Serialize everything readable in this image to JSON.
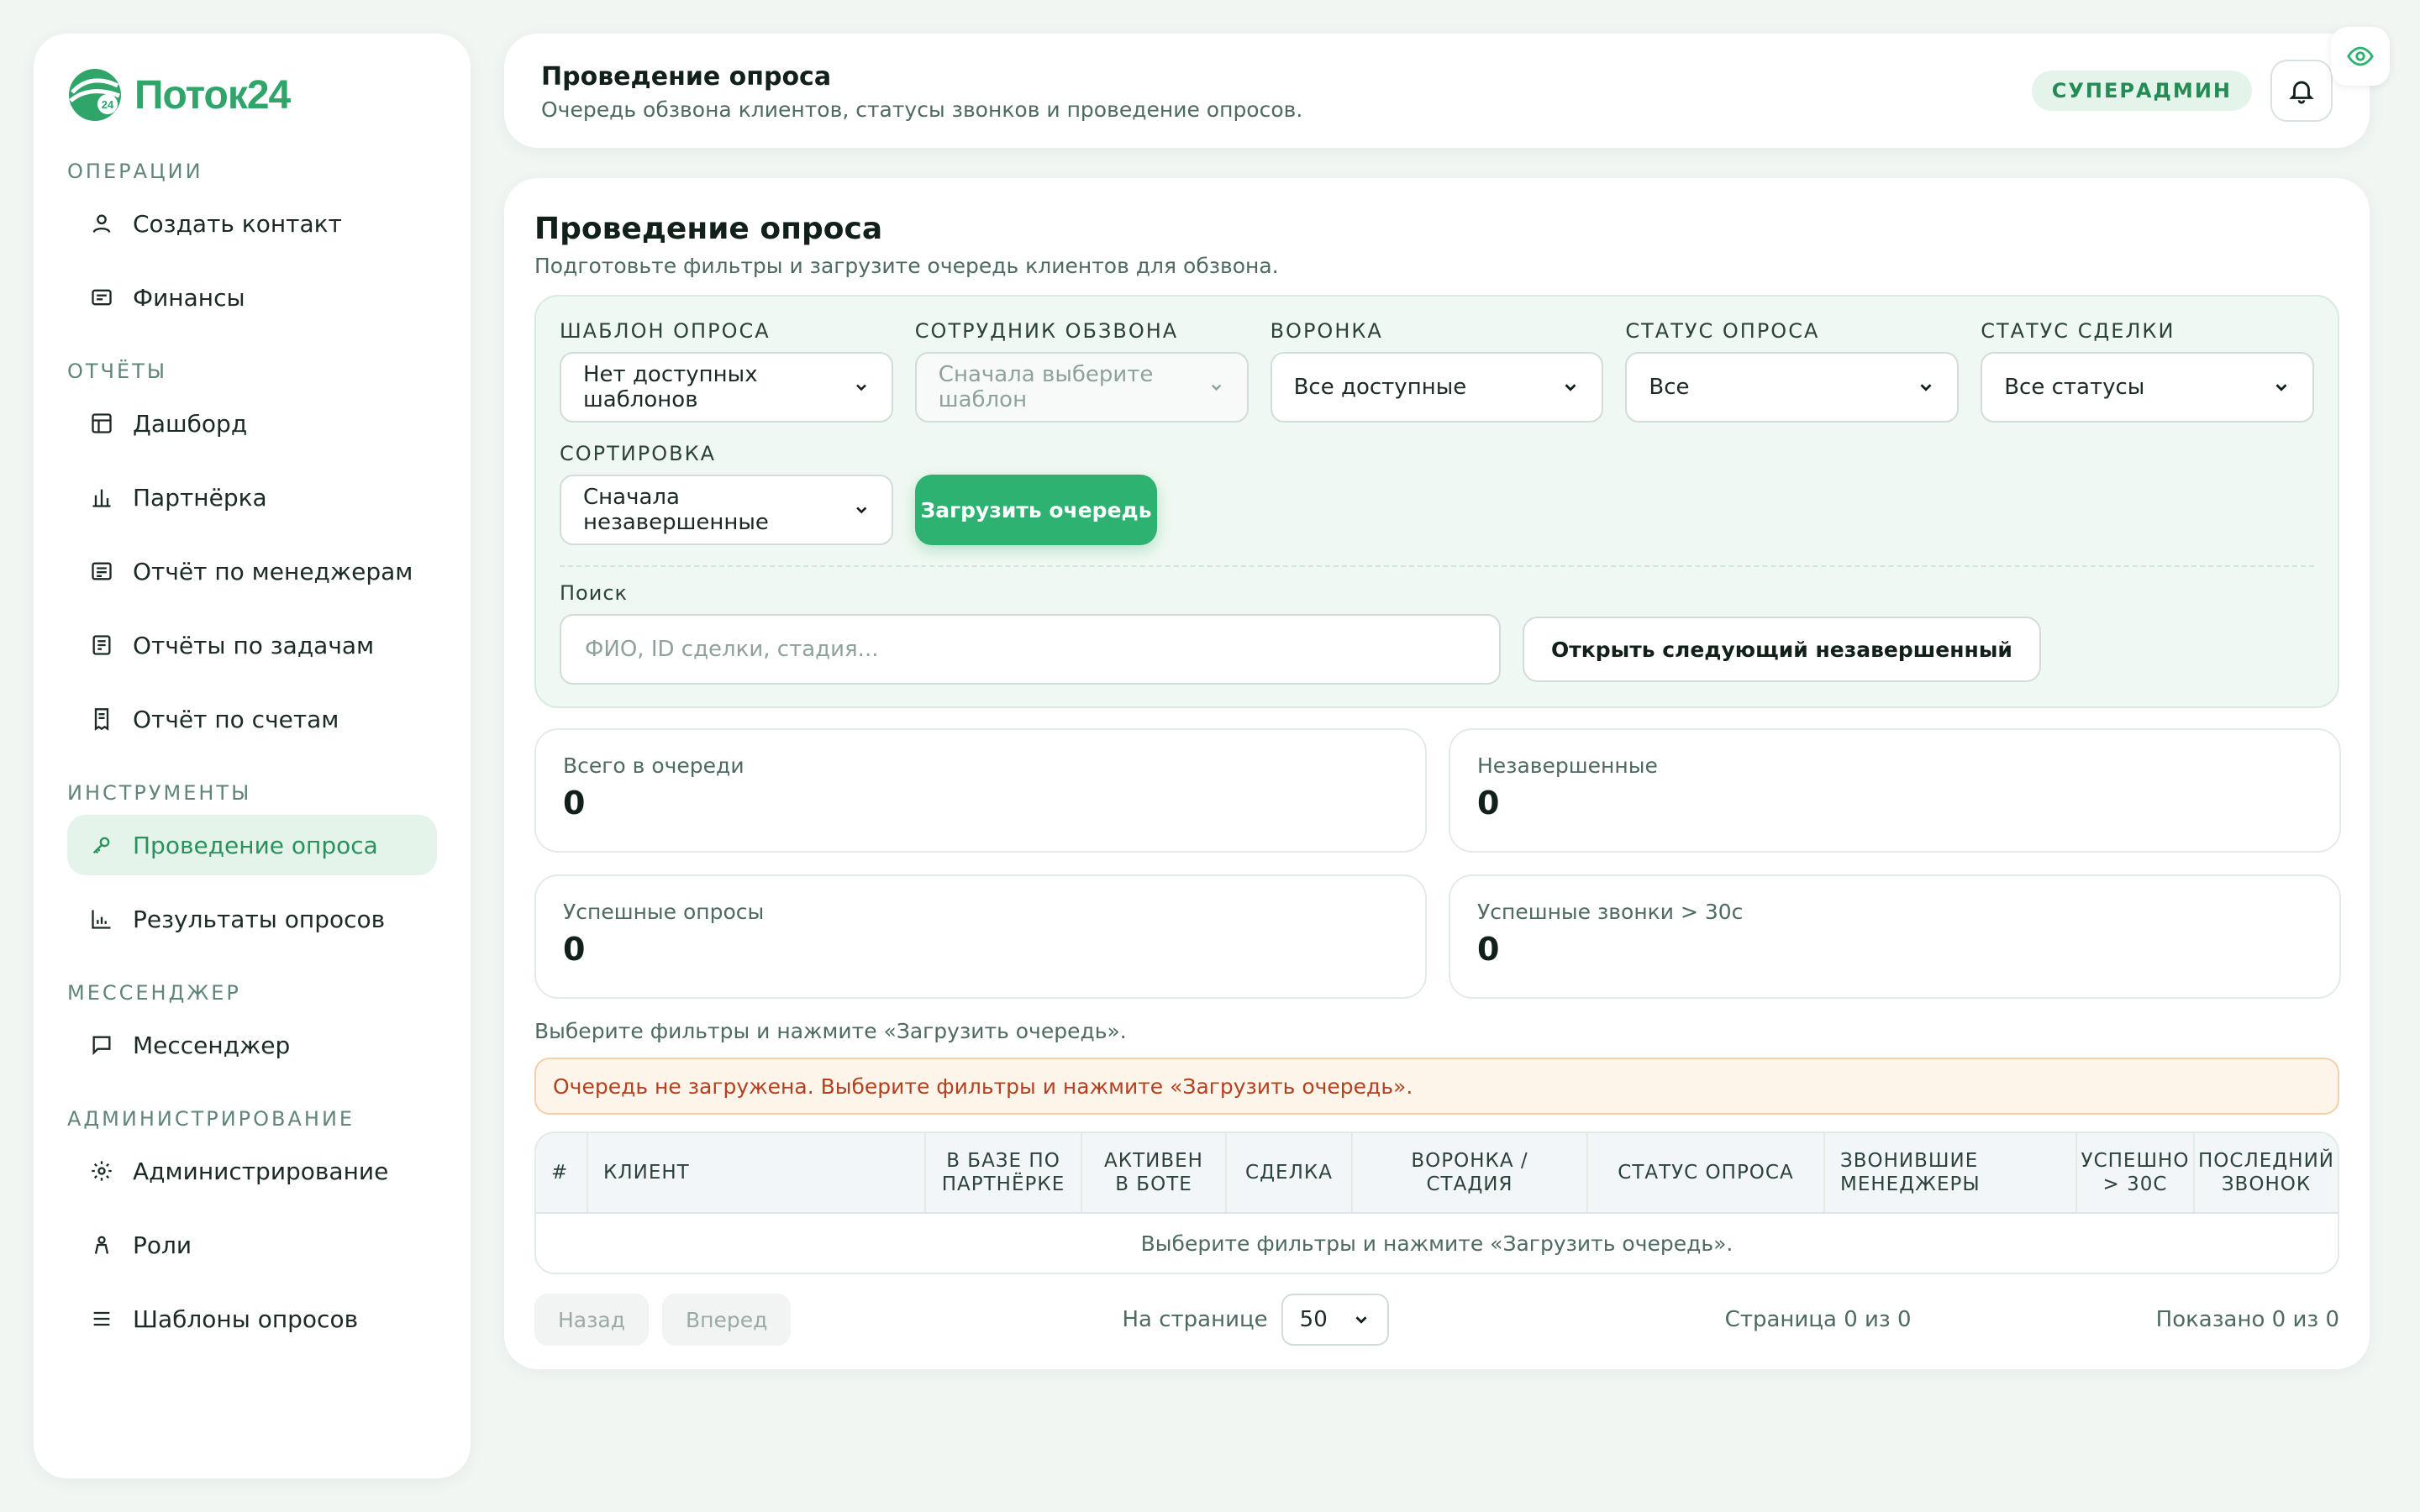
{
  "brand": {
    "name": "Поток24",
    "badge": "24",
    "color": "#2fa56a"
  },
  "sidebar": {
    "sections": [
      {
        "heading": "ОПЕРАЦИИ",
        "items": [
          {
            "label": "Создать контакт",
            "icon": "user-icon"
          },
          {
            "label": "Финансы",
            "icon": "wallet-icon"
          }
        ]
      },
      {
        "heading": "ОТЧЁТЫ",
        "items": [
          {
            "label": "Дашборд",
            "icon": "table-icon"
          },
          {
            "label": "Партнёрка",
            "icon": "bar-chart-icon"
          },
          {
            "label": "Отчёт по менеджерам",
            "icon": "list-card-icon"
          },
          {
            "label": "Отчёты по задачам",
            "icon": "tasks-icon"
          },
          {
            "label": "Отчёт по счетам",
            "icon": "receipt-icon"
          }
        ]
      },
      {
        "heading": "ИНСТРУМЕНТЫ",
        "items": [
          {
            "label": "Проведение опроса",
            "icon": "key-icon",
            "active": true
          },
          {
            "label": "Результаты опросов",
            "icon": "chart-icon"
          }
        ]
      },
      {
        "heading": "МЕССЕНДЖЕР",
        "items": [
          {
            "label": "Мессенджер",
            "icon": "chat-icon"
          }
        ]
      },
      {
        "heading": "АДМИНИСТРИРОВАНИЕ",
        "items": [
          {
            "label": "Администрирование",
            "icon": "gear-icon"
          },
          {
            "label": "Роли",
            "icon": "person-icon"
          },
          {
            "label": "Шаблоны опросов",
            "icon": "menu-icon"
          }
        ]
      }
    ]
  },
  "topbar": {
    "title": "Проведение опроса",
    "subtitle": "Очередь обзвона клиентов, статусы звонков и проведение опросов.",
    "role": "СУПЕРАДМИН"
  },
  "main": {
    "title": "Проведение опроса",
    "subtitle": "Подготовьте фильтры и загрузите очередь клиентов для обзвона.",
    "filters": {
      "template": {
        "label": "ШАБЛОН ОПРОСА",
        "value": "Нет доступных шаблонов"
      },
      "caller": {
        "label": "СОТРУДНИК ОБЗВОНА",
        "value": "Сначала выберите шаблон"
      },
      "funnel": {
        "label": "ВОРОНКА",
        "value": "Все доступные"
      },
      "survey_status": {
        "label": "СТАТУС ОПРОСА",
        "value": "Все"
      },
      "deal_status": {
        "label": "СТАТУС СДЕЛКИ",
        "value": "Все статусы"
      },
      "sort": {
        "label": "СОРТИРОВКА",
        "value": "Сначала незавершенные"
      },
      "load_button": "Загрузить очередь",
      "search_label": "Поиск",
      "search_placeholder": "ФИО, ID сделки, стадия...",
      "next_button": "Открыть следующий незавершенный"
    },
    "stats": [
      {
        "label": "Всего в очереди",
        "value": "0"
      },
      {
        "label": "Незавершенные",
        "value": "0"
      },
      {
        "label": "Успешные опросы",
        "value": "0"
      },
      {
        "label": "Успешные звонки > 30с",
        "value": "0"
      }
    ],
    "hint": "Выберите фильтры и нажмите «Загрузить очередь».",
    "warning": "Очередь не загружена. Выберите фильтры и нажмите «Загрузить очередь».",
    "table": {
      "columns": [
        "#",
        "КЛИЕНТ",
        "В БАЗЕ ПО ПАРТНЁРКЕ",
        "АКТИВЕН В БОТЕ",
        "СДЕЛКА",
        "ВОРОНКА / СТАДИЯ",
        "СТАТУС ОПРОСА",
        "ЗВОНИВШИЕ МЕНЕДЖЕРЫ",
        "УСПЕШНО > 30С",
        "ПОСЛЕДНИЙ ЗВОНОК"
      ],
      "empty": "Выберите фильтры и нажмите «Загрузить очередь»."
    },
    "pager": {
      "prev": "Назад",
      "next": "Вперед",
      "per_page_label": "На странице",
      "per_page": "50",
      "page_info": "Страница 0 из 0",
      "shown": "Показано 0 из 0"
    }
  }
}
